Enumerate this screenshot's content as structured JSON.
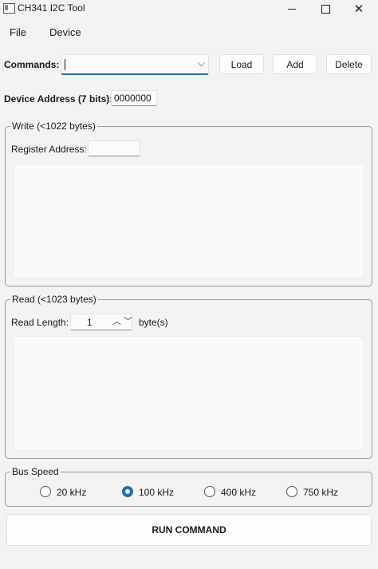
{
  "window": {
    "title": "CH341 I2C Tool",
    "close_glyph": "✕"
  },
  "menu": {
    "items": [
      "File",
      "Device"
    ]
  },
  "commands": {
    "label": "Commands:",
    "value": "",
    "load_label": "Load",
    "add_label": "Add",
    "delete_label": "Delete"
  },
  "device_address": {
    "label": "Device Address (7 bits):",
    "value": "0000000"
  },
  "write": {
    "title": "Write (<1022 bytes)",
    "register_label": "Register Address:",
    "register_value": ""
  },
  "read": {
    "title": "Read (<1023 bytes)",
    "length_label": "Read Length:",
    "length_value": "1",
    "unit_label": "byte(s)"
  },
  "bus_speed": {
    "title": "Bus Speed",
    "options": [
      "20 kHz",
      "100 kHz",
      "400 kHz",
      "750 kHz"
    ],
    "selected": "100 kHz"
  },
  "run_label": "RUN COMMAND",
  "colors": {
    "accent": "#1f6fb2",
    "background": "#f3f3f3"
  }
}
